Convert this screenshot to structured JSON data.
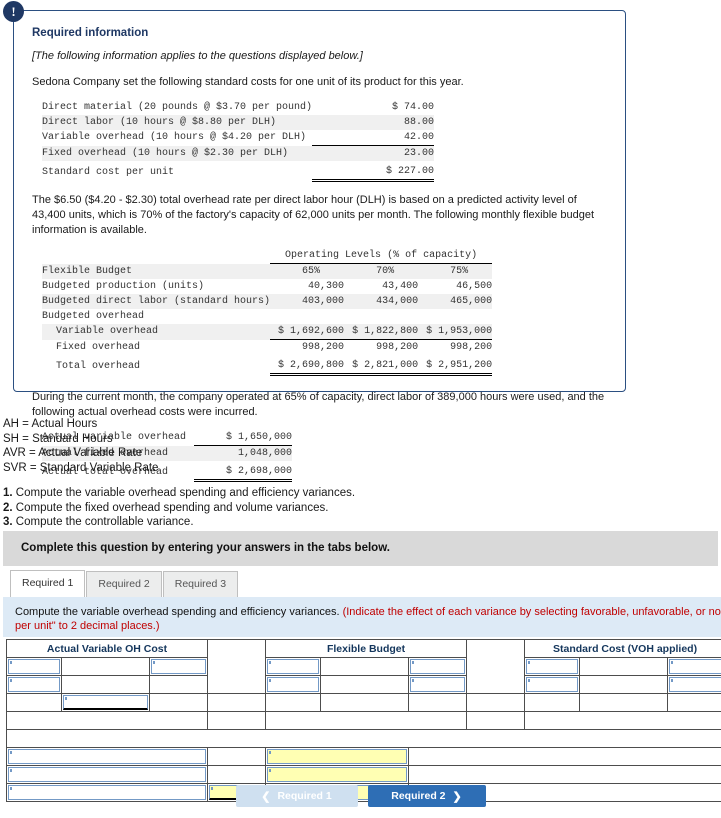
{
  "alert": {
    "icon": "exclamation-icon",
    "glyph": "!"
  },
  "panel": {
    "title": "Required information",
    "note": "[The following information applies to the questions displayed below.]",
    "intro": "Sedona Company set the following standard costs for one unit of its product for this year.",
    "standard_cost_table": {
      "rows": [
        {
          "label": "Direct material (20 pounds @ $3.70 per pound)",
          "value": "$ 74.00"
        },
        {
          "label": "Direct labor (10 hours @ $8.80 per DLH)",
          "value": "88.00"
        },
        {
          "label": "Variable overhead (10 hours @ $4.20 per DLH)",
          "value": "42.00"
        },
        {
          "label": "Fixed overhead (10 hours @ $2.30 per DLH)",
          "value": "23.00"
        }
      ],
      "total_label": "Standard cost per unit",
      "total_value": "$ 227.00"
    },
    "paragraph2": "The $6.50 ($4.20 - $2.30) total overhead rate per direct labor hour (DLH) is based on a predicted activity level of 43,400 units, which is 70% of the factory's capacity of 62,000 units per month. The following monthly flexible budget information is available.",
    "flex_budget_table": {
      "group_header": "Operating Levels (% of capacity)",
      "row_header_label": "Flexible Budget",
      "columns": [
        "65%",
        "70%",
        "75%"
      ],
      "rows": [
        {
          "label": "Budgeted production (units)",
          "values": [
            "40,300",
            "43,400",
            "46,500"
          ]
        },
        {
          "label": "Budgeted direct labor (standard hours)",
          "values": [
            "403,000",
            "434,000",
            "465,000"
          ]
        },
        {
          "label": "Budgeted overhead",
          "values": [
            "",
            "",
            ""
          ]
        },
        {
          "label": "Variable overhead",
          "values": [
            "$ 1,692,600",
            "$ 1,822,800",
            "$ 1,953,000"
          ]
        },
        {
          "label": "Fixed overhead",
          "values": [
            "998,200",
            "998,200",
            "998,200"
          ]
        }
      ],
      "total_label": "Total overhead",
      "total_values": [
        "$ 2,690,800",
        "$ 2,821,000",
        "$ 2,951,200"
      ]
    },
    "paragraph3": "During the current month, the company operated at 65% of capacity, direct labor of 389,000 hours were used, and the following actual overhead costs were incurred.",
    "actual_overhead_table": {
      "rows": [
        {
          "label": "Actual variable overhead",
          "value": "$ 1,650,000"
        },
        {
          "label": "Actual fixed overhead",
          "value": "1,048,000"
        }
      ],
      "total_label": "Actual total overhead",
      "total_value": "$ 2,698,000"
    }
  },
  "legend": {
    "lines": [
      "AH = Actual Hours",
      "SH = Standard Hours",
      "AVR = Actual Variable Rate",
      "SVR = Standard Variable Rate"
    ]
  },
  "steps": {
    "items": [
      {
        "num": "1.",
        "text": "Compute the variable overhead spending and efficiency variances."
      },
      {
        "num": "2.",
        "text": "Compute the fixed overhead spending and volume variances."
      },
      {
        "num": "3.",
        "text": "Compute the controllable variance."
      }
    ]
  },
  "complete_banner": {
    "text": "Complete this question by entering your answers in the tabs below."
  },
  "tabs": [
    {
      "label": "Required 1",
      "active": true
    },
    {
      "label": "Required 2",
      "active": false
    },
    {
      "label": "Required 3",
      "active": false
    }
  ],
  "instruction": {
    "black": "Compute the variable overhead spending and efficiency variances.",
    "red_line1": "(Indicate the effect of each variance by selecting favorable, unfavorable, or no variance. Round",
    "red_line2": "per unit\" to 2 decimal places.)"
  },
  "answer_grid": {
    "headers": [
      "Actual Variable OH Cost",
      "",
      "Flexible Budget",
      "",
      "Standard Cost (VOH applied)"
    ]
  },
  "nav": {
    "prev_label": "Required 1",
    "prev_icon": "chevron-left-icon",
    "next_label": "Required 2",
    "next_icon": "chevron-right-icon"
  },
  "colors": {
    "accent_blue": "#2e6eb5",
    "header_blue": "#6fa3dd",
    "panel_border": "#2b4f81",
    "instruction_bg": "#ddeaf6",
    "banner_bg": "#d9d9d9",
    "input_yellow": "#ffffb3",
    "red_text": "#c00000"
  }
}
